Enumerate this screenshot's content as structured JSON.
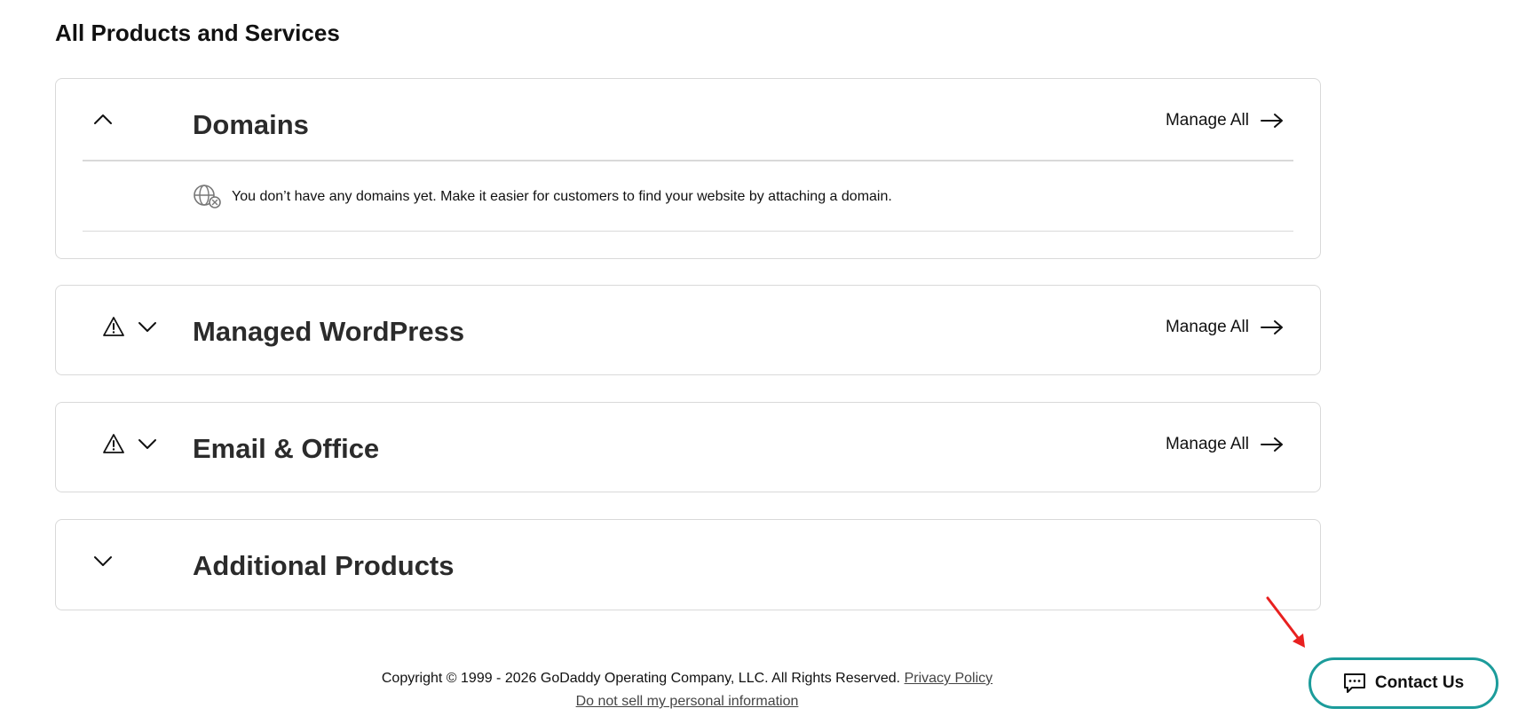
{
  "page": {
    "title": "All Products and Services"
  },
  "products": {
    "domains": {
      "title": "Domains",
      "manage_label": "Manage All",
      "empty_message": "You don’t have any domains yet. Make it easier for customers to find your website by attaching a domain.",
      "expanded": true
    },
    "wordpress": {
      "title": "Managed WordPress",
      "manage_label": "Manage All",
      "has_warning": true,
      "expanded": false
    },
    "email": {
      "title": "Email & Office",
      "manage_label": "Manage All",
      "has_warning": true,
      "expanded": false
    },
    "additional": {
      "title": "Additional Products",
      "expanded": false
    }
  },
  "footer": {
    "copyright": "Copyright © 1999 - 2026 GoDaddy Operating Company, LLC. All Rights Reserved.",
    "privacy_label": "Privacy Policy",
    "do_not_sell_label": "Do not sell my personal information"
  },
  "contact": {
    "label": "Contact Us"
  },
  "icons": {
    "collapse": "chevron-up-icon",
    "expand": "chevron-down-icon",
    "warning": "warning-triangle-icon",
    "no_domain": "globe-x-icon",
    "arrow": "arrow-right-icon",
    "chat": "chat-bubble-icon"
  },
  "colors": {
    "accent_teal": "#1c9c9b",
    "annotation_red": "#e8201f",
    "border": "#d9d9d9"
  }
}
